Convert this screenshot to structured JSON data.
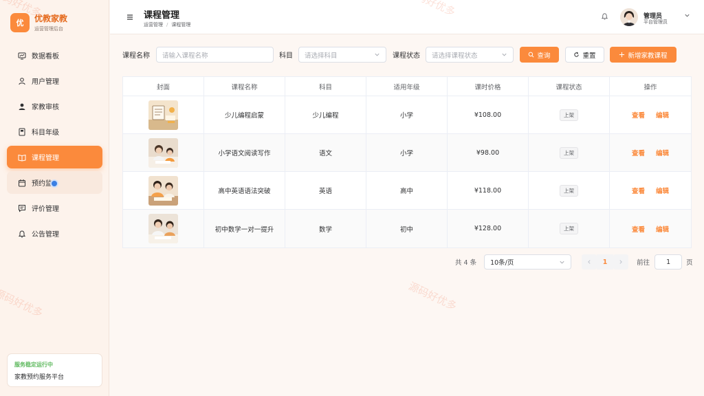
{
  "app": {
    "logo_char": "优",
    "title": "优教家教",
    "subtitle": "运营管理后台"
  },
  "sidebar": {
    "items": [
      {
        "label": "数据看板",
        "icon": "dashboard-icon"
      },
      {
        "label": "用户管理",
        "icon": "user-icon"
      },
      {
        "label": "家教审核",
        "icon": "user-check-icon"
      },
      {
        "label": "科目年级",
        "icon": "book-icon"
      },
      {
        "label": "课程管理",
        "icon": "open-book-icon",
        "active": true
      },
      {
        "label": "预约监",
        "icon": "calendar-icon"
      },
      {
        "label": "评价管理",
        "icon": "comment-icon"
      },
      {
        "label": "公告管理",
        "icon": "bell-icon"
      }
    ],
    "status_card": {
      "title": "服务稳定运行中",
      "desc": "家教预约服务平台"
    }
  },
  "header": {
    "title": "课程管理",
    "breadcrumb": [
      "运营管理",
      "课程管理"
    ],
    "user": {
      "name": "管理员",
      "role": "平台管理员"
    }
  },
  "filters": {
    "name_label": "课程名称",
    "name_placeholder": "请输入课程名称",
    "subject_label": "科目",
    "subject_placeholder": "请选择科目",
    "status_label": "课程状态",
    "status_placeholder": "请选择课程状态",
    "query_label": "查询",
    "reset_label": "重置",
    "add_label": "新增家教课程"
  },
  "table": {
    "headers": [
      "封面",
      "课程名称",
      "科目",
      "适用年级",
      "课时价格",
      "课程状态",
      "操作"
    ],
    "rows": [
      {
        "name": "少儿编程启蒙",
        "subject": "少儿编程",
        "grade": "小学",
        "price": "¥108.00",
        "status": "上架",
        "view": "查看",
        "edit": "编辑"
      },
      {
        "name": "小学语文阅读写作",
        "subject": "语文",
        "grade": "小学",
        "price": "¥98.00",
        "status": "上架",
        "view": "查看",
        "edit": "编辑"
      },
      {
        "name": "高中英语语法突破",
        "subject": "英语",
        "grade": "高中",
        "price": "¥118.00",
        "status": "上架",
        "view": "查看",
        "edit": "编辑"
      },
      {
        "name": "初中数学一对一提升",
        "subject": "数学",
        "grade": "初中",
        "price": "¥128.00",
        "status": "上架",
        "view": "查看",
        "edit": "编辑"
      }
    ]
  },
  "pagination": {
    "total": "共 4 条",
    "page_size": "10条/页",
    "current": "1",
    "goto_label": "前往",
    "goto_value": "1",
    "page_suffix": "页"
  },
  "watermark": "源码好优多",
  "colors": {
    "accent": "#fb8a3c",
    "success": "#5cb85c"
  }
}
